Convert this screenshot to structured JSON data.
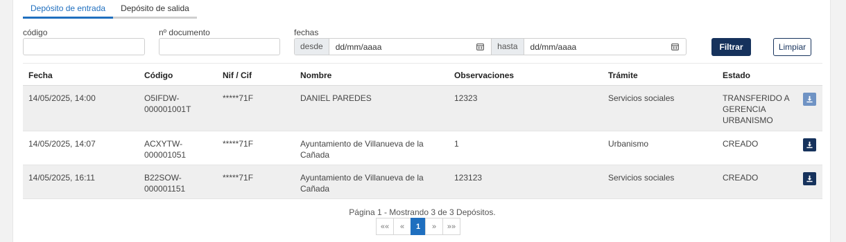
{
  "tabs": [
    {
      "label": "Depósito de entrada",
      "active": true
    },
    {
      "label": "Depósito de salida",
      "active": false
    }
  ],
  "filters": {
    "codigo_label": "código",
    "codigo_value": "",
    "documento_label": "nº documento",
    "documento_value": "",
    "fechas_label": "fechas",
    "desde_label": "desde",
    "desde_placeholder": "dd/mm/aaaa",
    "hasta_label": "hasta",
    "hasta_placeholder": "dd/mm/aaaa",
    "filtrar_label": "Filtrar",
    "limpiar_label": "Limpiar"
  },
  "table": {
    "headers": [
      "Fecha",
      "Código",
      "Nif / Cif",
      "Nombre",
      "Observaciones",
      "Trámite",
      "Estado"
    ],
    "rows": [
      {
        "fecha": "14/05/2025, 14:00",
        "codigo": [
          "O5IFDW-",
          "000001001T"
        ],
        "nif": "*****71F",
        "nombre": [
          "DANIEL PAREDES"
        ],
        "observaciones": "12323",
        "tramite": "Servicios sociales",
        "estado": [
          "TRANSFERIDO A",
          "GERENCIA",
          "URBANISMO"
        ],
        "download_icon": "download-icon"
      },
      {
        "fecha": "14/05/2025, 14:07",
        "codigo": [
          "ACXYTW-",
          "000001051"
        ],
        "nif": "*****71F",
        "nombre": [
          "Ayuntamiento de Villanueva de la",
          "Cañada"
        ],
        "observaciones": "1",
        "tramite": "Urbanismo",
        "estado": [
          "CREADO"
        ],
        "download_icon": "download-icon"
      },
      {
        "fecha": "14/05/2025, 16:11",
        "codigo": [
          "B22SOW-",
          "000001151"
        ],
        "nif": "*****71F",
        "nombre": [
          "Ayuntamiento de Villanueva de la",
          "Cañada"
        ],
        "observaciones": "123123",
        "tramite": "Servicios sociales",
        "estado": [
          "CREADO"
        ],
        "download_icon": "download-icon"
      }
    ]
  },
  "pagination": {
    "info": "Página 1 - Mostrando 3 de 3 Depósitos.",
    "first": "«« ",
    "prev": "«",
    "current": "1",
    "next": "»",
    "last": "»»"
  },
  "colors": {
    "primary": "#16325c",
    "accent": "#1f6fbf",
    "row_alt": "#efefef"
  }
}
